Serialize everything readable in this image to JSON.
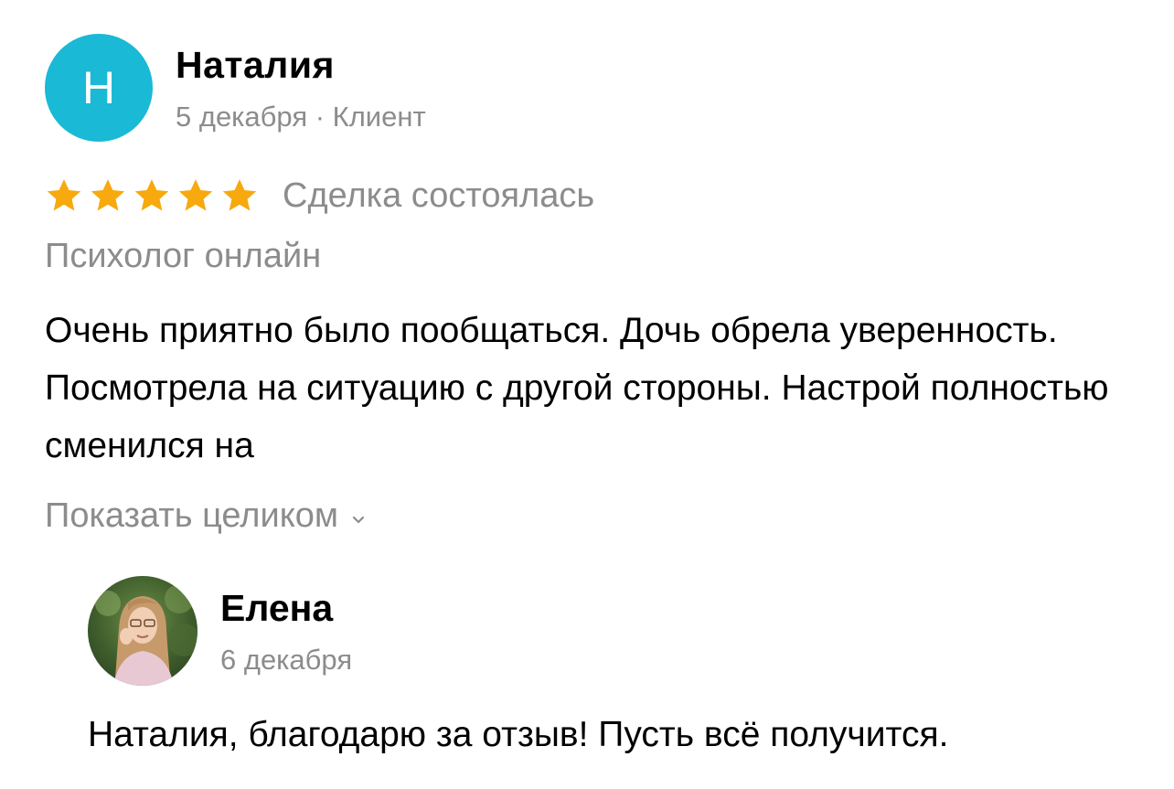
{
  "review": {
    "avatar_letter": "Н",
    "avatar_color": "#1ab9d6",
    "author": "Наталия",
    "meta": "5 декабря · Клиент",
    "rating": 5,
    "rating_max": 5,
    "star_color": "#f7a90d",
    "deal_status": "Сделка состоялась",
    "service": "Психолог онлайн",
    "text": "Очень приятно было пообщаться. Дочь обрела уверенность. Посмотрела на ситуацию с другой стороны. Настрой полностью сменился на",
    "show_more_label": "Показать целиком",
    "show_more_icon": "chevron-down-icon"
  },
  "reply": {
    "author": "Елена",
    "date": "6 декабря",
    "text": "Наталия, благодарю за отзыв! Пусть всё получится."
  }
}
